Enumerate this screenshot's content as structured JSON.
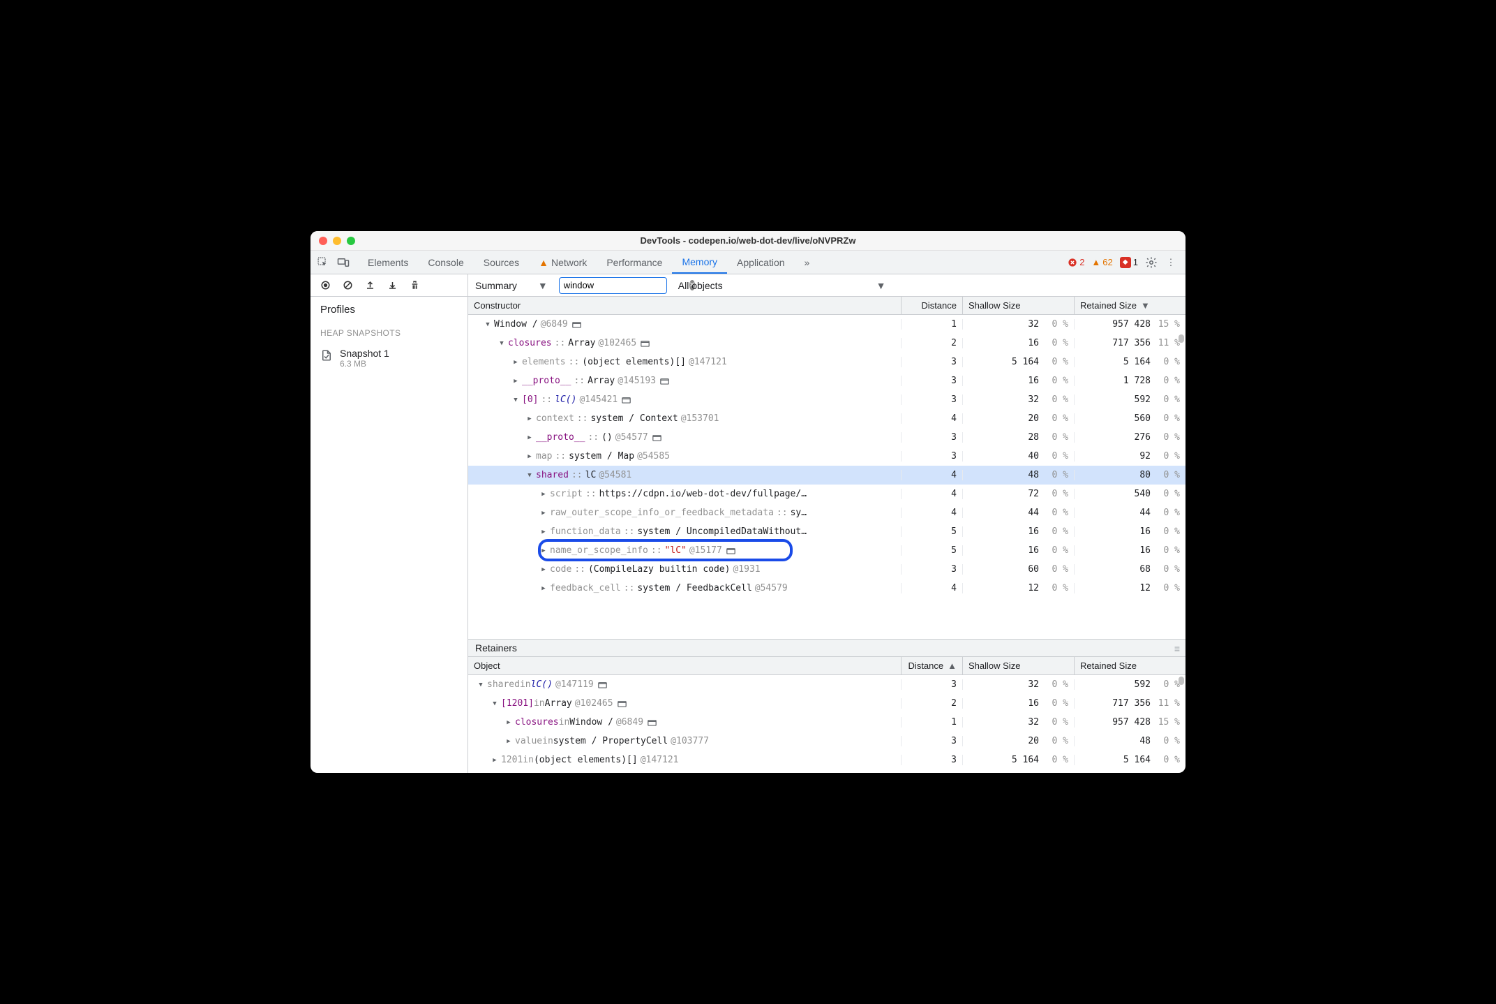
{
  "window_title": "DevTools - codepen.io/web-dot-dev/live/oNVPRZw",
  "tabs": {
    "elements": "Elements",
    "console": "Console",
    "sources": "Sources",
    "network": "Network",
    "performance": "Performance",
    "memory": "Memory",
    "application": "Application",
    "overflow": "»"
  },
  "errors": {
    "err_count": "2",
    "warn_count": "62",
    "block_count": "1"
  },
  "toolbar": {
    "summary_label": "Summary",
    "filter_value": "window",
    "all_objects_label": "All objects"
  },
  "sidebar": {
    "profiles": "Profiles",
    "heap_section": "HEAP SNAPSHOTS",
    "snapshot_name": "Snapshot 1",
    "snapshot_size": "6.3 MB"
  },
  "grid_headers": {
    "constructor": "Constructor",
    "distance": "Distance",
    "shallow": "Shallow Size",
    "retained": "Retained Size"
  },
  "tree": [
    {
      "indent": 0,
      "exp": "open",
      "parts": [
        {
          "t": "Window /",
          "c": "black"
        },
        {
          "t": "@6849",
          "c": "at"
        },
        {
          "open": true
        }
      ],
      "dist": "1",
      "sh": "32",
      "shp": "0 %",
      "ret": "957 428",
      "retp": "15 %"
    },
    {
      "indent": 1,
      "exp": "open",
      "parts": [
        {
          "t": "closures",
          "c": "purple"
        },
        {
          "t": "::",
          "c": "sep"
        },
        {
          "t": "Array",
          "c": "black"
        },
        {
          "t": "@102465",
          "c": "at"
        },
        {
          "open": true
        }
      ],
      "dist": "2",
      "sh": "16",
      "shp": "0 %",
      "ret": "717 356",
      "retp": "11 %"
    },
    {
      "indent": 2,
      "exp": "closed",
      "parts": [
        {
          "t": "elements",
          "c": "gray"
        },
        {
          "t": "::",
          "c": "sep"
        },
        {
          "t": "(object elements)[]",
          "c": "black"
        },
        {
          "t": "@147121",
          "c": "at"
        }
      ],
      "dist": "3",
      "sh": "5 164",
      "shp": "0 %",
      "ret": "5 164",
      "retp": "0 %"
    },
    {
      "indent": 2,
      "exp": "closed",
      "parts": [
        {
          "t": "__proto__",
          "c": "purple"
        },
        {
          "t": "::",
          "c": "sep"
        },
        {
          "t": "Array",
          "c": "black"
        },
        {
          "t": "@145193",
          "c": "at"
        },
        {
          "open": true
        }
      ],
      "dist": "3",
      "sh": "16",
      "shp": "0 %",
      "ret": "1 728",
      "retp": "0 %"
    },
    {
      "indent": 2,
      "exp": "open",
      "parts": [
        {
          "t": "[0]",
          "c": "purple"
        },
        {
          "t": "::",
          "c": "sep"
        },
        {
          "t": "lC()",
          "c": "blue",
          "i": true
        },
        {
          "t": "@145421",
          "c": "at"
        },
        {
          "open": true
        }
      ],
      "dist": "3",
      "sh": "32",
      "shp": "0 %",
      "ret": "592",
      "retp": "0 %"
    },
    {
      "indent": 3,
      "exp": "closed",
      "parts": [
        {
          "t": "context",
          "c": "gray"
        },
        {
          "t": "::",
          "c": "sep"
        },
        {
          "t": "system / Context",
          "c": "black"
        },
        {
          "t": "@153701",
          "c": "at"
        }
      ],
      "dist": "4",
      "sh": "20",
      "shp": "0 %",
      "ret": "560",
      "retp": "0 %"
    },
    {
      "indent": 3,
      "exp": "closed",
      "parts": [
        {
          "t": "__proto__",
          "c": "purple"
        },
        {
          "t": "::",
          "c": "sep"
        },
        {
          "t": "()",
          "c": "black"
        },
        {
          "t": "@54577",
          "c": "at"
        },
        {
          "open": true
        }
      ],
      "dist": "3",
      "sh": "28",
      "shp": "0 %",
      "ret": "276",
      "retp": "0 %"
    },
    {
      "indent": 3,
      "exp": "closed",
      "parts": [
        {
          "t": "map",
          "c": "gray"
        },
        {
          "t": "::",
          "c": "sep"
        },
        {
          "t": "system / Map",
          "c": "black"
        },
        {
          "t": "@54585",
          "c": "at"
        }
      ],
      "dist": "3",
      "sh": "40",
      "shp": "0 %",
      "ret": "92",
      "retp": "0 %"
    },
    {
      "indent": 3,
      "exp": "open",
      "sel": true,
      "parts": [
        {
          "t": "shared",
          "c": "purple"
        },
        {
          "t": "::",
          "c": "sep"
        },
        {
          "t": "lC",
          "c": "black"
        },
        {
          "t": "@54581",
          "c": "at"
        }
      ],
      "dist": "4",
      "sh": "48",
      "shp": "0 %",
      "ret": "80",
      "retp": "0 %"
    },
    {
      "indent": 4,
      "exp": "closed",
      "parts": [
        {
          "t": "script",
          "c": "gray"
        },
        {
          "t": "::",
          "c": "sep"
        },
        {
          "t": "https://cdpn.io/web-dot-dev/fullpage/…",
          "c": "black"
        }
      ],
      "dist": "4",
      "sh": "72",
      "shp": "0 %",
      "ret": "540",
      "retp": "0 %"
    },
    {
      "indent": 4,
      "exp": "closed",
      "parts": [
        {
          "t": "raw_outer_scope_info_or_feedback_metadata",
          "c": "gray"
        },
        {
          "t": "::",
          "c": "sep"
        },
        {
          "t": "sy…",
          "c": "black"
        }
      ],
      "dist": "4",
      "sh": "44",
      "shp": "0 %",
      "ret": "44",
      "retp": "0 %"
    },
    {
      "indent": 4,
      "exp": "closed",
      "parts": [
        {
          "t": "function_data",
          "c": "gray"
        },
        {
          "t": "::",
          "c": "sep"
        },
        {
          "t": "system / UncompiledDataWithout…",
          "c": "black"
        }
      ],
      "dist": "5",
      "sh": "16",
      "shp": "0 %",
      "ret": "16",
      "retp": "0 %"
    },
    {
      "indent": 4,
      "exp": "closed",
      "hl": true,
      "parts": [
        {
          "t": "name_or_scope_info",
          "c": "gray"
        },
        {
          "t": "::",
          "c": "sep"
        },
        {
          "t": "\"lC\"",
          "c": "red"
        },
        {
          "t": "@15177",
          "c": "at"
        },
        {
          "open": true
        }
      ],
      "dist": "5",
      "sh": "16",
      "shp": "0 %",
      "ret": "16",
      "retp": "0 %"
    },
    {
      "indent": 4,
      "exp": "closed",
      "parts": [
        {
          "t": "code",
          "c": "gray"
        },
        {
          "t": "::",
          "c": "sep"
        },
        {
          "t": "(CompileLazy builtin code)",
          "c": "black"
        },
        {
          "t": "@1931",
          "c": "at"
        }
      ],
      "dist": "3",
      "sh": "60",
      "shp": "0 %",
      "ret": "68",
      "retp": "0 %"
    },
    {
      "indent": 4,
      "exp": "closed",
      "parts": [
        {
          "t": "feedback_cell",
          "c": "gray"
        },
        {
          "t": "::",
          "c": "sep"
        },
        {
          "t": "system / FeedbackCell",
          "c": "black"
        },
        {
          "t": "@54579",
          "c": "at"
        }
      ],
      "dist": "4",
      "sh": "12",
      "shp": "0 %",
      "ret": "12",
      "retp": "0 %"
    }
  ],
  "retainers_label": "Retainers",
  "retain_headers": {
    "object": "Object",
    "distance": "Distance",
    "shallow": "Shallow Size",
    "retained": "Retained Size"
  },
  "retain_rows": [
    {
      "indent": 0,
      "exp": "open",
      "parts": [
        {
          "t": "shared",
          "c": "gray"
        },
        {
          "t": " in ",
          "c": "gray2"
        },
        {
          "t": "lC()",
          "c": "blue",
          "i": true
        },
        {
          "t": "@147119",
          "c": "at"
        },
        {
          "open": true
        }
      ],
      "dist": "3",
      "sh": "32",
      "shp": "0 %",
      "ret": "592",
      "retp": "0 %"
    },
    {
      "indent": 1,
      "exp": "open",
      "parts": [
        {
          "t": "[1201]",
          "c": "purple"
        },
        {
          "t": " in ",
          "c": "gray2"
        },
        {
          "t": "Array",
          "c": "black"
        },
        {
          "t": "@102465",
          "c": "at"
        },
        {
          "open": true
        }
      ],
      "dist": "2",
      "sh": "16",
      "shp": "0 %",
      "ret": "717 356",
      "retp": "11 %"
    },
    {
      "indent": 2,
      "exp": "closed",
      "parts": [
        {
          "t": "closures",
          "c": "purple"
        },
        {
          "t": " in ",
          "c": "gray2"
        },
        {
          "t": "Window /",
          "c": "black"
        },
        {
          "t": "@6849",
          "c": "at"
        },
        {
          "open": true
        }
      ],
      "dist": "1",
      "sh": "32",
      "shp": "0 %",
      "ret": "957 428",
      "retp": "15 %"
    },
    {
      "indent": 2,
      "exp": "closed",
      "parts": [
        {
          "t": "value",
          "c": "gray"
        },
        {
          "t": " in ",
          "c": "gray2"
        },
        {
          "t": "system / PropertyCell",
          "c": "black"
        },
        {
          "t": "@103777",
          "c": "at"
        }
      ],
      "dist": "3",
      "sh": "20",
      "shp": "0 %",
      "ret": "48",
      "retp": "0 %"
    },
    {
      "indent": 1,
      "exp": "closed",
      "parts": [
        {
          "t": "1201",
          "c": "gray"
        },
        {
          "t": " in ",
          "c": "gray2"
        },
        {
          "t": "(object elements)[]",
          "c": "black"
        },
        {
          "t": "@147121",
          "c": "at"
        }
      ],
      "dist": "3",
      "sh": "5 164",
      "shp": "0 %",
      "ret": "5 164",
      "retp": "0 %"
    }
  ]
}
